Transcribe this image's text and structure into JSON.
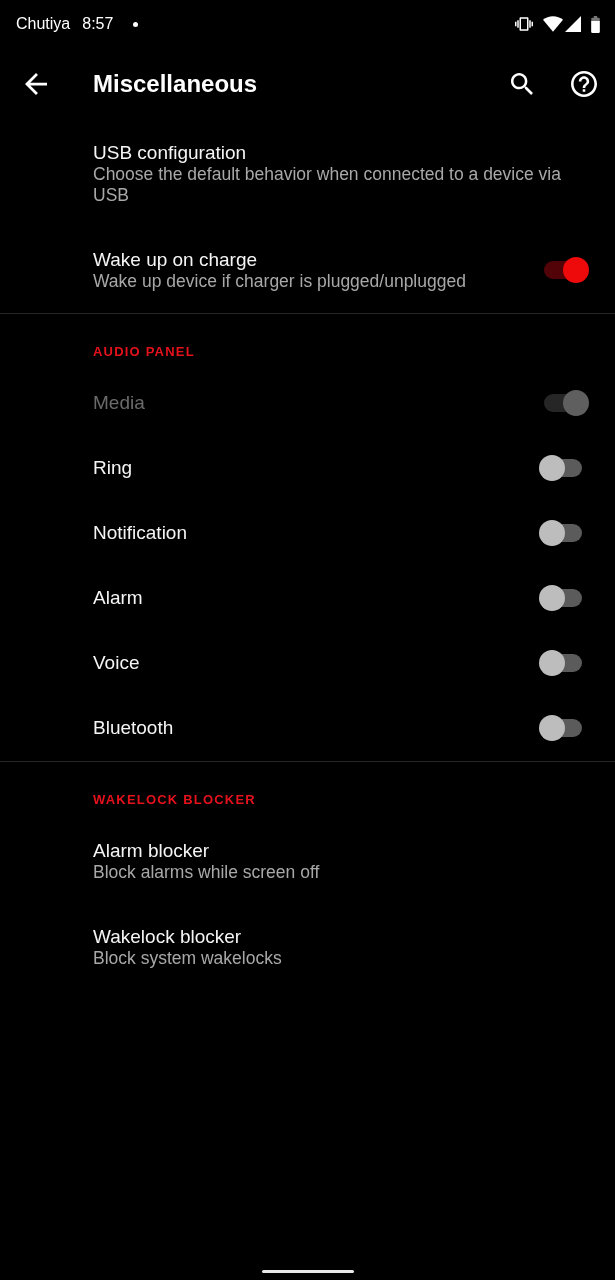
{
  "status_bar": {
    "carrier": "Chutiya",
    "time": "8:57"
  },
  "app_bar": {
    "title": "Miscellaneous"
  },
  "sections": [
    {
      "items": [
        {
          "kind": "text",
          "title": "USB configuration",
          "summary": "Choose the default behavior when connected to a device via USB"
        },
        {
          "kind": "switch",
          "title": "Wake up on charge",
          "summary": "Wake up device if charger is plugged/unplugged",
          "on": true,
          "disabled": false
        }
      ]
    },
    {
      "header": "AUDIO PANEL",
      "items": [
        {
          "kind": "switch",
          "title": "Media",
          "on": true,
          "disabled": true
        },
        {
          "kind": "switch",
          "title": "Ring",
          "on": false,
          "disabled": false
        },
        {
          "kind": "switch",
          "title": "Notification",
          "on": false,
          "disabled": false
        },
        {
          "kind": "switch",
          "title": "Alarm",
          "on": false,
          "disabled": false
        },
        {
          "kind": "switch",
          "title": "Voice",
          "on": false,
          "disabled": false
        },
        {
          "kind": "switch",
          "title": "Bluetooth",
          "on": false,
          "disabled": false
        }
      ]
    },
    {
      "header": "WAKELOCK BLOCKER",
      "items": [
        {
          "kind": "text",
          "title": "Alarm blocker",
          "summary": "Block alarms while screen off"
        },
        {
          "kind": "text",
          "title": "Wakelock blocker",
          "summary": "Block system wakelocks"
        }
      ]
    }
  ]
}
